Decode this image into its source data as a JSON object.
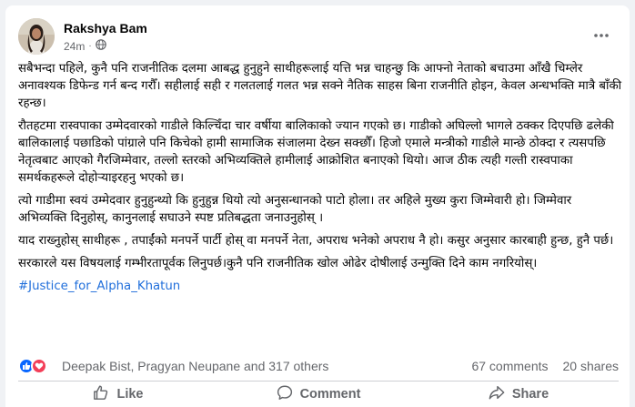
{
  "post": {
    "author": "Rakshya Bam",
    "time": "24m",
    "paragraphs": [
      "सबैभन्दा पहिले, कुनै पनि राजनीतिक दलमा आबद्ध हुनुहुने साथीहरूलाई यत्ति भन्न चाहन्छु कि आफ्नो नेताको बचाउमा आँखै चिम्लेर अनावश्यक डिफेन्ड गर्न बन्द गरौँ। सहीलाई सही र गलतलाई गलत भन्न सक्ने नैतिक साहस बिना राजनीति होइन, केवल अन्धभक्ति मात्रै बाँकी रहन्छ।",
      "रौतहटमा रास्वपाका उम्मेदवारको गाडीले किल्चिँदा चार वर्षीया बालिकाको ज्यान गएको छ। गाडीको अघिल्लो भागले ठक्कर दिएपछि ढलेकी बालिकालाई पछाडिको पांग्राले पनि किचेको हामी सामाजिक संजालमा देख्न सक्छौँ। हिजो एमाले मन्त्रीको गाडीले मान्छे ठोक्दा र त्यसपछि नेतृत्वबाट आएको गैरजिम्मेवार, तल्लो स्तरको अभिव्यक्तिले हामीलाई आक्रोशित बनाएको थियो। आज ठीक त्यही गल्ती रास्वपाका समर्थकहरूले दोहोर्‍याइरहनु भएको छ।",
      "त्यो गाडीमा स्वयं उम्मेदवार हुनुहुन्थ्यो कि हुनुहुन्न थियो त्यो अनुसन्धानको पाटो होला। तर अहिले मुख्य कुरा जिम्मेवारी हो। जिम्मेवार अभिव्यक्ति दिनुहोस्, कानुनलाई सघाउने स्पष्ट प्रतिबद्धता जनाउनुहोस् ।",
      "याद राख्नुहोस् साथीहरू , तपाईंको मनपर्ने पार्टी होस् वा मनपर्ने नेता, अपराध भनेको अपराध नै हो। कसुर अनुसार कारबाही हुन्छ, हुनै पर्छ।",
      "सरकारले यस विषयलाई गम्भीरतापूर्वक लिनुपर्छ।कुनै पनि राजनीतिक खोल ओढेर दोषीलाई उन्मुक्ति दिने काम नगरियोस्।"
    ],
    "hashtag": "#Justice_for_Alpha_Khatun"
  },
  "reactions": {
    "names": "Deepak Bist, Pragyan Neupane and 317 others",
    "comments": "67 comments",
    "shares": "20 shares"
  },
  "actions": {
    "like": "Like",
    "comment": "Comment",
    "share": "Share"
  },
  "colors": {
    "like_blue": "#0866ff",
    "love_red": "#f33e58",
    "link_blue": "#216fdb",
    "muted": "#65676b"
  },
  "icons": {
    "globe": "globe-icon",
    "more": "more-options-icon",
    "like": "thumbs-up-icon",
    "love": "heart-icon",
    "comment": "comment-bubble-icon",
    "share": "share-arrow-icon"
  }
}
